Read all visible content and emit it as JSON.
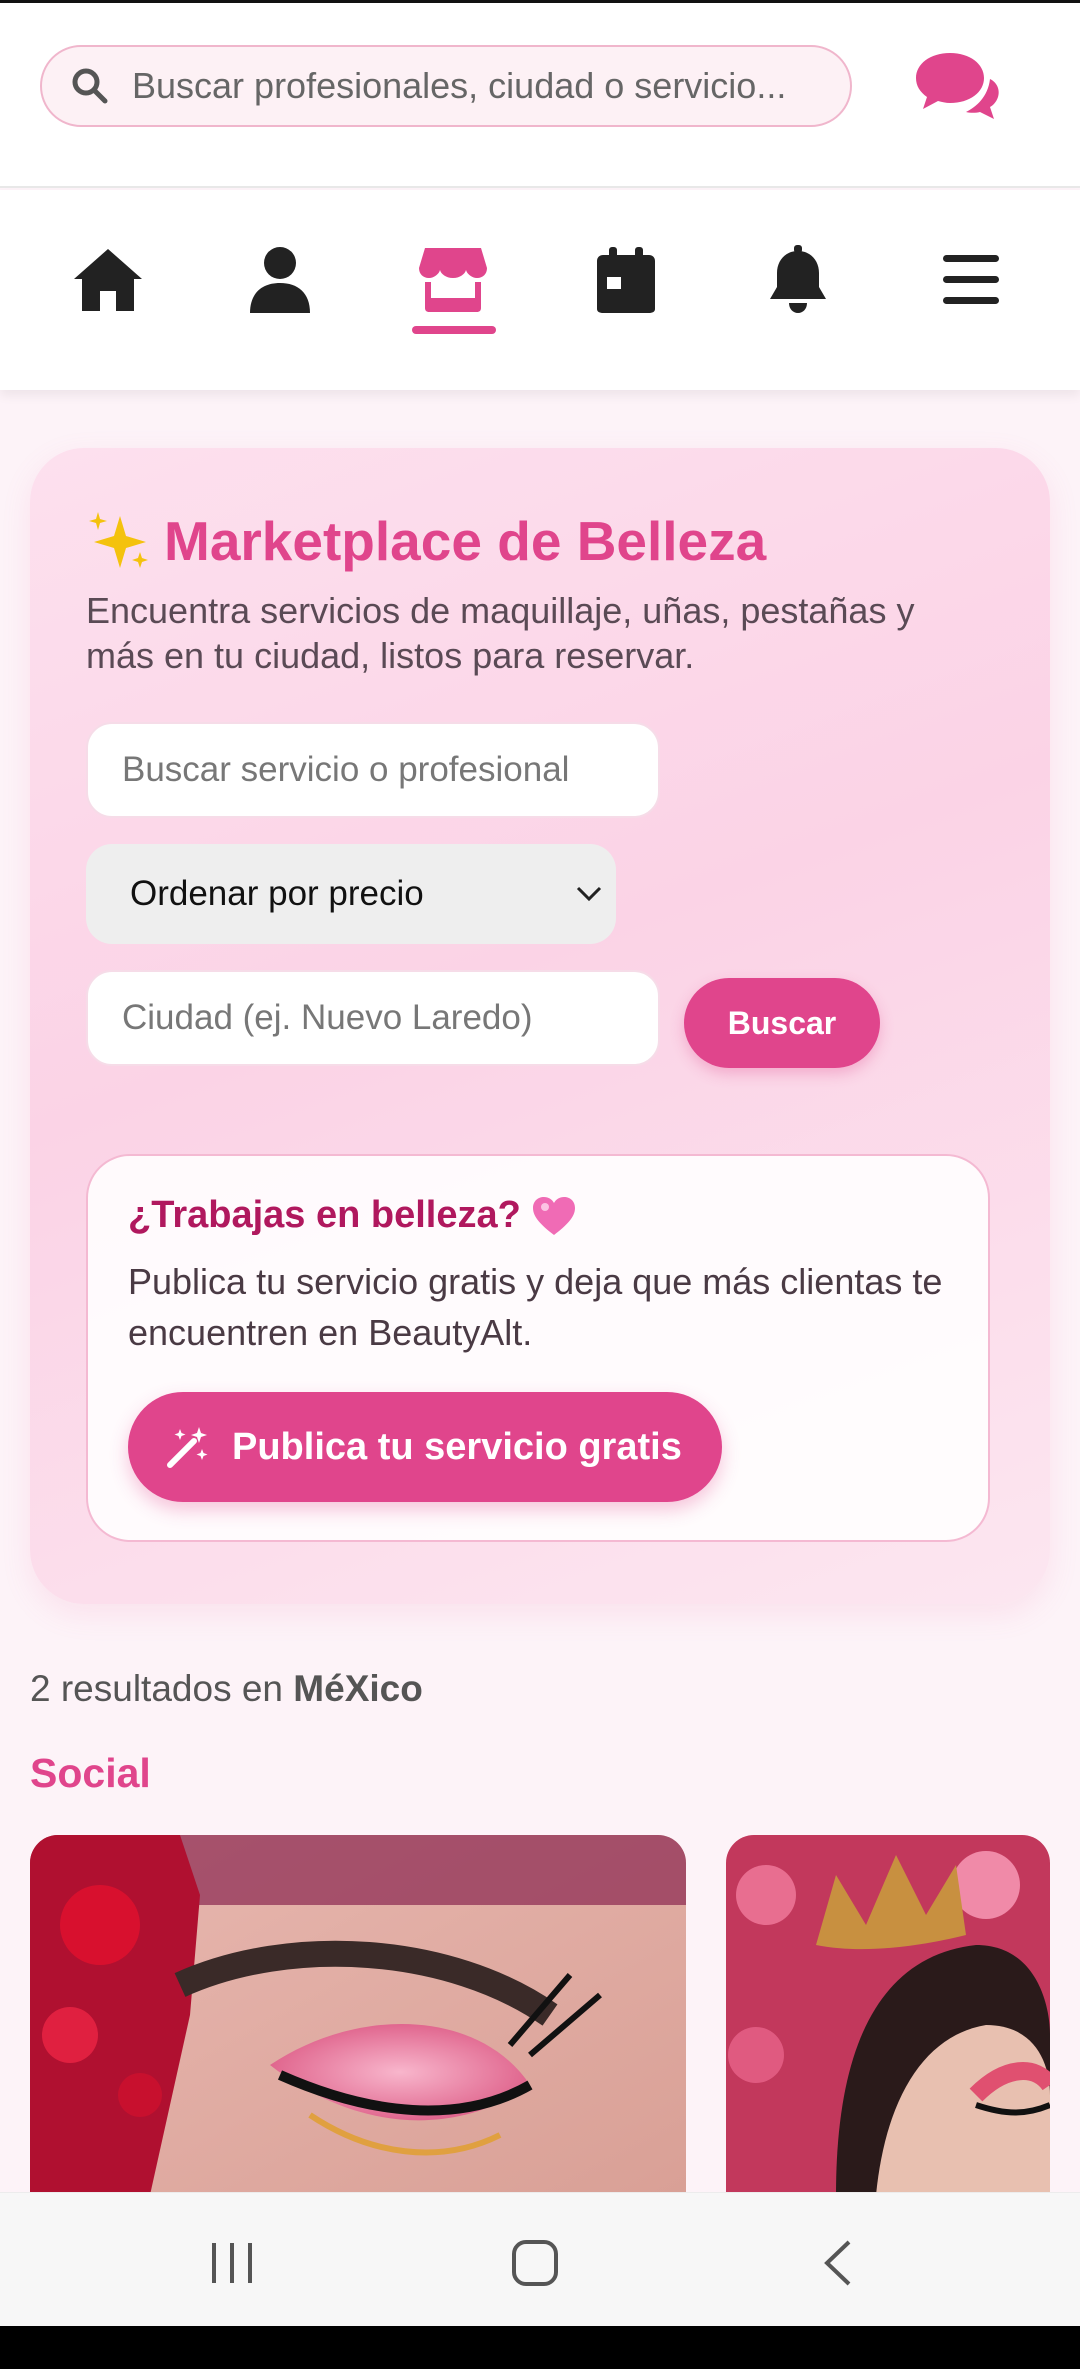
{
  "header": {
    "search_placeholder": "Buscar profesionales, ciudad o servicio...",
    "icons": [
      "search-icon",
      "chat-bubbles-icon"
    ]
  },
  "nav": {
    "items": [
      {
        "icon": "home-icon"
      },
      {
        "icon": "user-icon"
      },
      {
        "icon": "store-icon",
        "active": true
      },
      {
        "icon": "calendar-icon"
      },
      {
        "icon": "bell-icon"
      },
      {
        "icon": "menu-icon"
      }
    ],
    "accent": "#e0458c"
  },
  "hero": {
    "title": "Marketplace de Belleza",
    "title_icon": "sparkles-icon",
    "subtitle": "Encuentra servicios de maquillaje, uñas, pestañas y más en tu ciudad, listos para reservar.",
    "search_placeholder": "Buscar servicio o profesional",
    "sort_selected": "Ordenar por precio",
    "city_placeholder": "Ciudad (ej. Nuevo Laredo)",
    "search_button": "Buscar"
  },
  "promo": {
    "title": "¿Trabajas en belleza?",
    "title_icon": "heart-icon",
    "text": "Publica tu servicio gratis y deja que más clientas te encuentren en BeautyAlt.",
    "button_label": "Publica tu servicio gratis",
    "button_icon": "magic-wand-icon"
  },
  "results": {
    "count_prefix": "2 resultados en",
    "location": "MéXico",
    "category": "Social"
  },
  "colors": {
    "brand": "#e0458c",
    "promo_title": "#b0185e",
    "hero_bg": "#fbd3e6"
  }
}
